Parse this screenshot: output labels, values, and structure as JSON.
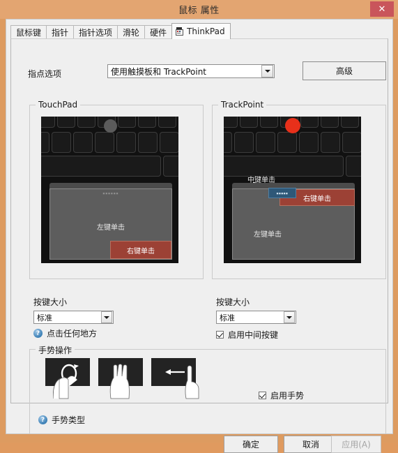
{
  "window": {
    "title": "鼠标 属性",
    "close_label": "✕"
  },
  "tabs": [
    {
      "label": "鼠标键",
      "active": false
    },
    {
      "label": "指针",
      "active": false
    },
    {
      "label": "指针选项",
      "active": false
    },
    {
      "label": "滑轮",
      "active": false
    },
    {
      "label": "硬件",
      "active": false
    },
    {
      "label": "ThinkPad",
      "active": true
    }
  ],
  "pointing": {
    "label": "指点选项",
    "selected": "使用触摸板和 TrackPoint",
    "advanced_button": "高级"
  },
  "touchpad": {
    "group_title": "TouchPad",
    "faint_marking": "■■■■■■",
    "left_click_label": "左键单击",
    "right_click_label": "右键单击",
    "size_label": "按键大小",
    "size_value": "标准",
    "help_text": "点击任何地方",
    "help_icon": "?"
  },
  "trackpoint": {
    "group_title": "TrackPoint",
    "middle_click_label": "中键单击",
    "middle_button_caption": "■■■■■",
    "left_click_label": "左键单击",
    "right_click_label": "右键单击",
    "size_label": "按键大小",
    "size_value": "标准",
    "enable_middle_label": "启用中间按键",
    "enable_middle_checked": true
  },
  "gestures": {
    "group_title": "手势操作",
    "items": [
      {
        "name": "pinch-rotate-gesture"
      },
      {
        "name": "three-finger-swipe-gesture"
      },
      {
        "name": "edge-swipe-gesture"
      }
    ],
    "enable_label": "启用手势",
    "enable_checked": true,
    "help_text": "手势类型",
    "help_icon": "?"
  },
  "footer": {
    "ok": "确定",
    "cancel": "取消",
    "apply": "应用(A)",
    "apply_disabled": true
  },
  "colors": {
    "window_frame": "#dd9b60",
    "titlebar": "#e3a571",
    "close_button": "#c9555b",
    "dialog_bg": "#efefef",
    "trackpoint_red": "#e8301a",
    "right_button_red": "#9c4135",
    "middle_button_blue": "#2e5878"
  }
}
